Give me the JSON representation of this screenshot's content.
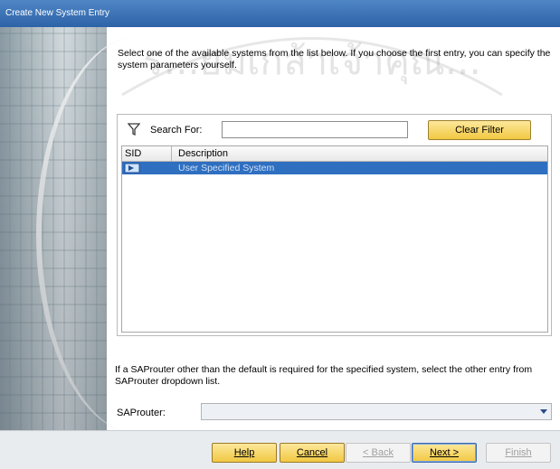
{
  "window": {
    "title": "Create New System Entry"
  },
  "instruction": "Select one of the available systems from the list below. If you choose the first entry, you can specify the system parameters yourself.",
  "search": {
    "label": "Search For:",
    "value": "",
    "clear_filter_label": "Clear Filter"
  },
  "grid": {
    "columns": [
      "SID",
      "Description"
    ],
    "rows": [
      {
        "sid": "",
        "description": "User Specified System",
        "selected": true
      }
    ]
  },
  "saprouter": {
    "note": "If a SAProuter other than the default is required for the specified system, select the other entry from SAProuter dropdown list.",
    "label": "SAProuter:",
    "selected_value": ""
  },
  "footer": {
    "help": "Help",
    "cancel": "Cancel",
    "back": "< Back",
    "next": "Next >",
    "finish": "Finish"
  },
  "watermark_text": "ร...ยมเกล้าเจ้าคุณ...",
  "colors": {
    "title_bar": "#2d63a8",
    "selection": "#2f6fc0",
    "button": "#f1c842"
  }
}
